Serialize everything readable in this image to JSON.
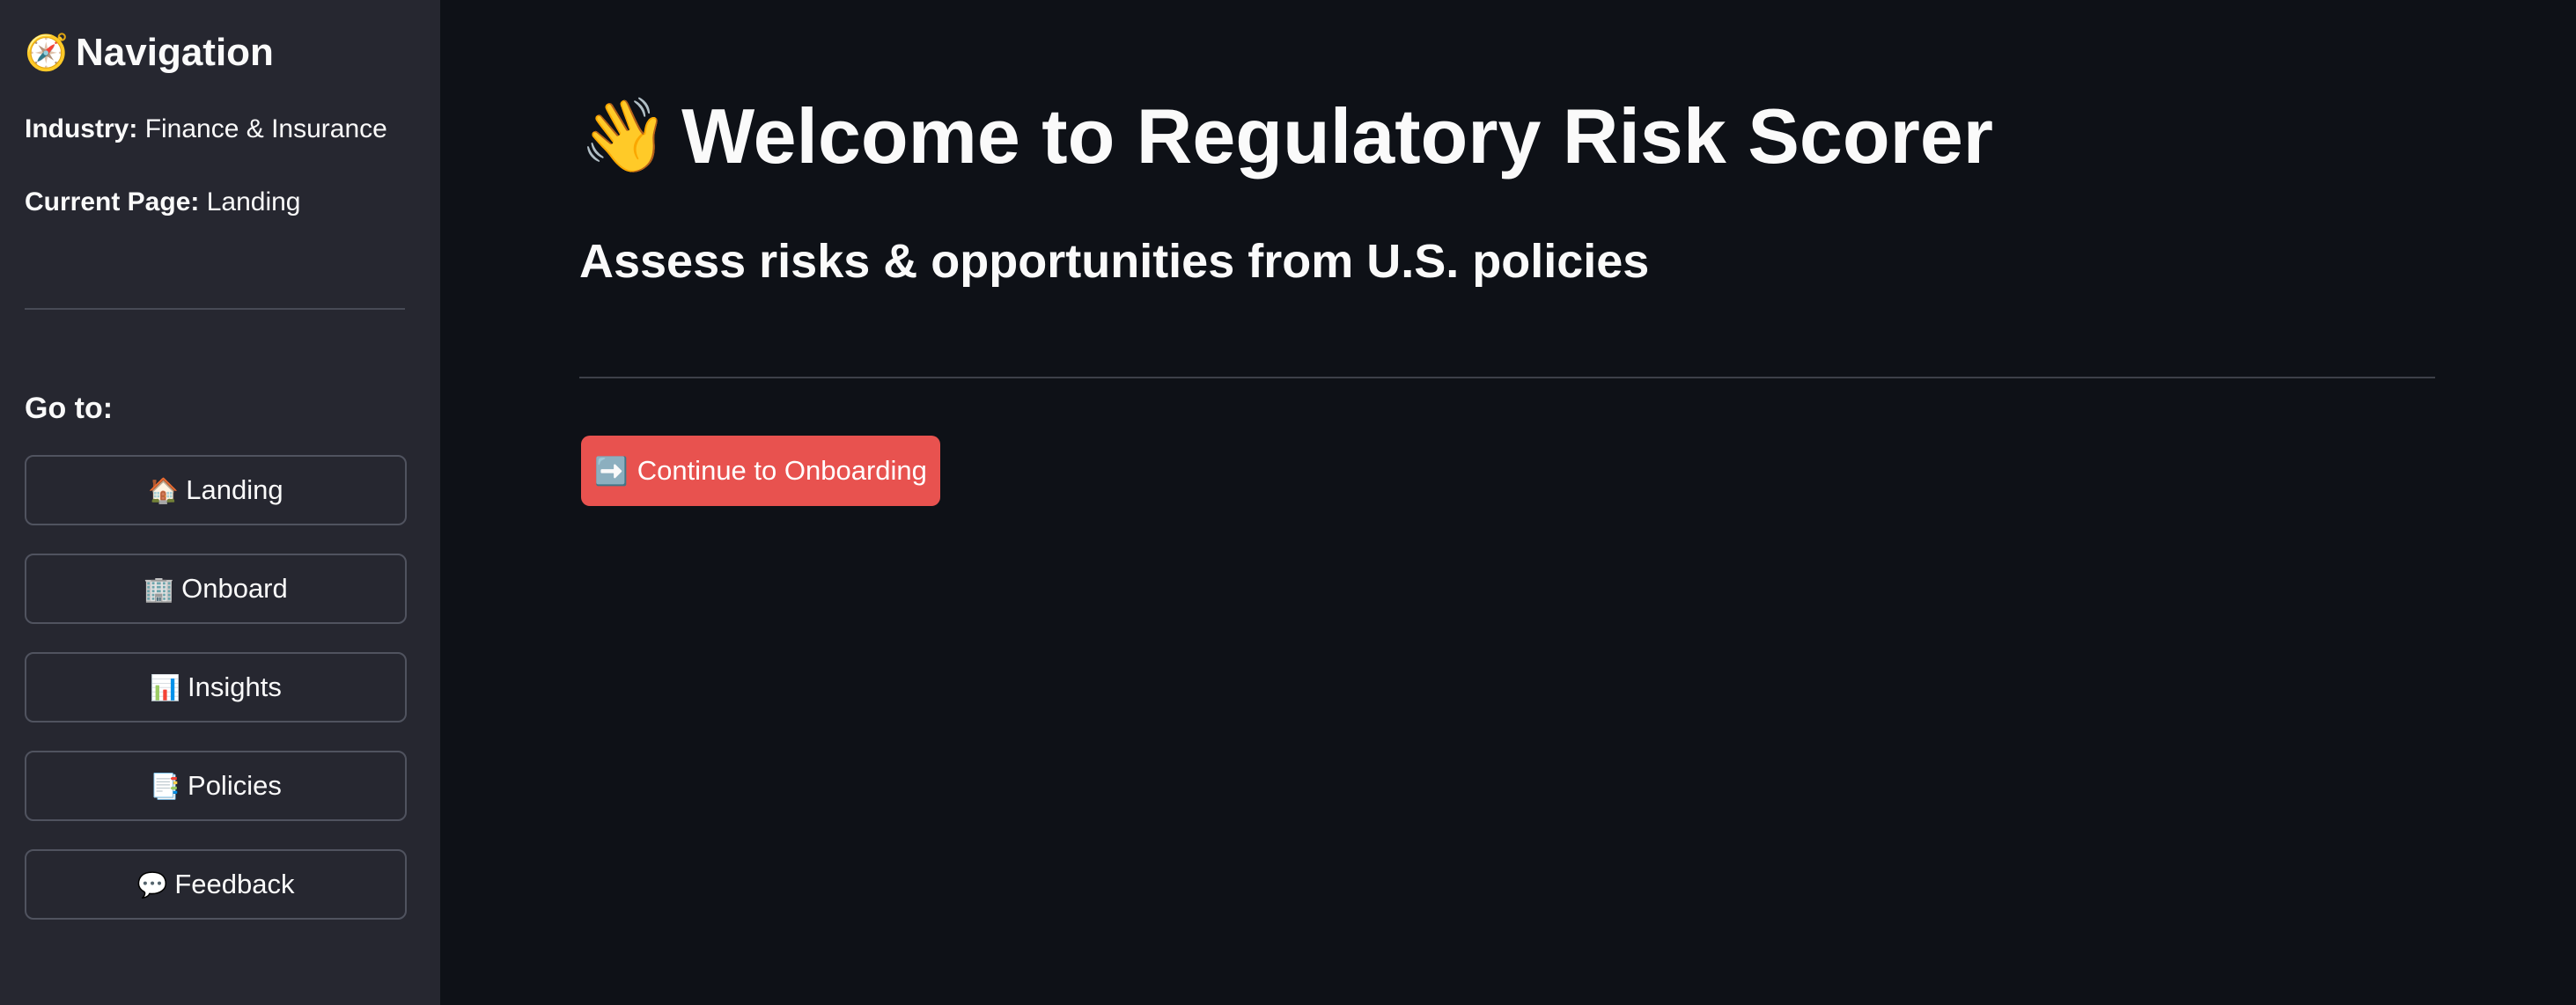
{
  "sidebar": {
    "title_emoji": "🧭",
    "title": "Navigation",
    "industry_label": "Industry:",
    "industry_value": "Finance & Insurance",
    "current_page_label": "Current Page:",
    "current_page_value": "Landing",
    "goto_label": "Go to:",
    "nav": [
      {
        "emoji": "🏠",
        "label": "Landing"
      },
      {
        "emoji": "🏢",
        "label": "Onboard"
      },
      {
        "emoji": "📊",
        "label": "Insights"
      },
      {
        "emoji": "📑",
        "label": "Policies"
      },
      {
        "emoji": "💬",
        "label": "Feedback"
      }
    ]
  },
  "main": {
    "title_emoji": "👋",
    "title": "Welcome to Regulatory Risk Scorer",
    "subtitle": "Assess risks & opportunities from U.S. policies",
    "cta_emoji": "➡️",
    "cta_label": "Continue to Onboarding"
  },
  "colors": {
    "app_background": "#0e1117",
    "sidebar_background": "#262730",
    "primary_button": "#e8524f",
    "text": "#fafafa"
  }
}
